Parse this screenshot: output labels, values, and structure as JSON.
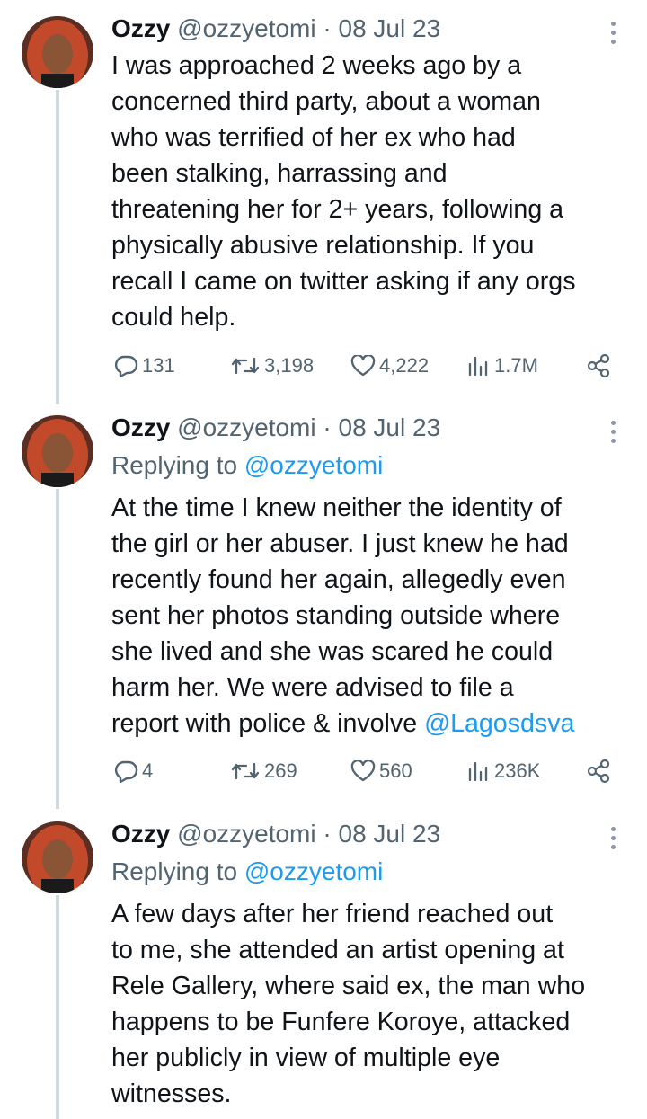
{
  "tweets": [
    {
      "display_name": "Ozzy",
      "handle": "@ozzyetomi",
      "date": "· 08 Jul 23",
      "replying_prefix": "",
      "replying_to": "",
      "lines": [
        "I was approached 2 weeks ago by a",
        "concerned third party, about a woman",
        "who was terrified of her ex who had",
        "been stalking, harrassing and",
        "threatening her for 2+ years, following a",
        "physically abusive relationship. If you",
        "recall I came on twitter asking if any orgs",
        "could help."
      ],
      "replies": "131",
      "retweets": "3,198",
      "likes": "4,222",
      "views": "1.7M"
    },
    {
      "display_name": "Ozzy",
      "handle": "@ozzyetomi",
      "date": "· 08 Jul 23",
      "replying_prefix": "Replying to",
      "replying_to": "@ozzyetomi",
      "lines": [
        "At the time I knew neither the identity of",
        "the girl or her abuser. I just knew he had",
        "recently found her again, allegedly even",
        "sent her photos standing outside where",
        "she lived and she was scared he could",
        "harm her. We were advised to file a",
        "report with police & involve"
      ],
      "mention": "@Lagosdsva",
      "replies": "4",
      "retweets": "269",
      "likes": "560",
      "views": "236K"
    },
    {
      "display_name": "Ozzy",
      "handle": "@ozzyetomi",
      "date": "· 08 Jul 23",
      "replying_prefix": "Replying to",
      "replying_to": "@ozzyetomi",
      "lines": [
        "A few days after her friend reached out",
        "to me, she attended an artist opening at",
        "Rele Gallery, where said ex, the man who",
        "happens to be Funfere Koroye, attacked",
        "her publicly in view of multiple eye",
        "witnesses."
      ]
    }
  ],
  "colors": {
    "text": "#0f1419",
    "secondary": "#536471",
    "link": "#1d9bf0",
    "thread_line": "#cfd9de"
  },
  "icons": [
    "more-icon",
    "reply-icon",
    "retweet-icon",
    "like-icon",
    "views-icon",
    "share-icon"
  ]
}
